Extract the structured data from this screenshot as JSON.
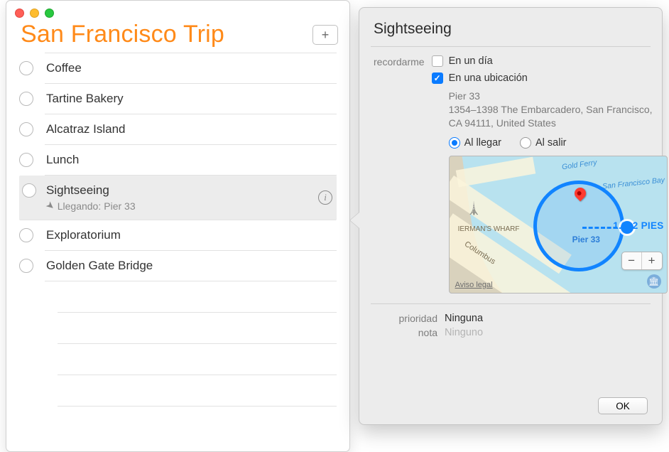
{
  "list": {
    "title": "San Francisco Trip",
    "add_glyph": "+",
    "items": [
      {
        "label": "Coffee"
      },
      {
        "label": "Tartine Bakery"
      },
      {
        "label": "Alcatraz Island"
      },
      {
        "label": "Lunch"
      },
      {
        "label": "Sightseeing",
        "sub_prefix": "Llegando:",
        "sub_place": "Pier 33",
        "selected": true
      },
      {
        "label": "Exploratorium"
      },
      {
        "label": "Golden Gate Bridge"
      }
    ]
  },
  "panel": {
    "title": "Sightseeing",
    "remind_label": "recordarme",
    "day_label": "En un día",
    "location_label": "En una ubicación",
    "address_name": "Pier 33",
    "address_full": "1354–1398 The Embarcadero, San Francisco, CA  94111, United States",
    "arrive_label": "Al llegar",
    "leave_label": "Al salir",
    "priority_label": "prioridad",
    "priority_value": "Ninguna",
    "note_label": "nota",
    "note_placeholder": "Ninguno",
    "ok_label": "OK"
  },
  "map": {
    "radius_label": "1.312 PIES",
    "pier_label": "Pier 33",
    "legal_label": "Aviso legal",
    "columbus": "Columbus",
    "ferman": "IERMAN'S\nWHARF",
    "ferry": "Gold Ferry",
    "bay": "San Francisco Bay",
    "zoom_out": "−",
    "zoom_in": "+",
    "museum_glyph": "🏛"
  }
}
